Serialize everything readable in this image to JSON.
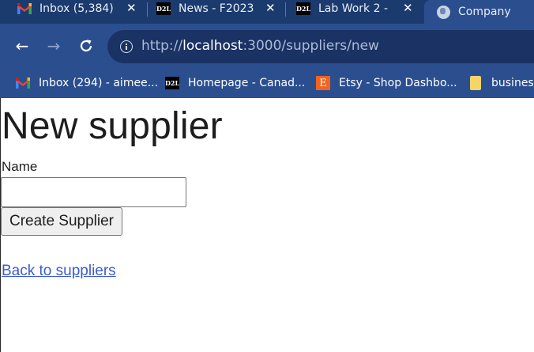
{
  "browser": {
    "tabs": [
      {
        "label": "Inbox (5,384)",
        "icon": "gmail-icon"
      },
      {
        "label": "News - F2023",
        "icon": "d2l-icon"
      },
      {
        "label": "Lab Work 2 -",
        "icon": "d2l-icon"
      },
      {
        "label": "Company",
        "icon": "globe-icon"
      }
    ],
    "d2l_text": "D2L",
    "url_prefix": "http://",
    "url_host": "localhost",
    "url_rest": ":3000/suppliers/new",
    "bookmarks": [
      {
        "label": "Inbox (294) - aimee...",
        "icon": "gmail-icon"
      },
      {
        "label": "Homepage - Canad...",
        "icon": "d2l-icon"
      },
      {
        "label": "Etsy - Shop Dashbo...",
        "icon": "etsy-icon"
      },
      {
        "label": "business",
        "icon": "folder-icon"
      }
    ],
    "etsy_letter": "E",
    "colors": {
      "chrome": "#2b4e8f",
      "tabstrip": "#1b3a6e",
      "omnibox": "#1a3264"
    }
  },
  "page": {
    "title": "New supplier",
    "name_label": "Name",
    "name_value": "",
    "submit_label": "Create Supplier",
    "back_link": "Back to suppliers",
    "link_color": "#3b5bd1"
  }
}
